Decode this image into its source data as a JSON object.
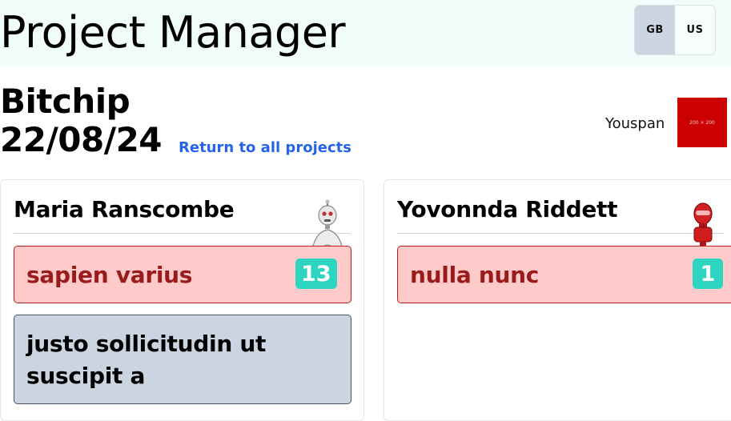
{
  "app": {
    "title": "Project Manager"
  },
  "locales": {
    "gb": "GB",
    "us": "US",
    "selected": "GB"
  },
  "project": {
    "name": "Bitchip",
    "date": "22/08/24",
    "return_link": "Return to all projects",
    "client": "Youspan",
    "client_logo_text": "200 × 200",
    "client_logo_color": "#cc0000"
  },
  "members": [
    {
      "name": "Maria Ranscombe",
      "avatar": "robot-avatar-white",
      "tasks": [
        {
          "title": "sapien varius",
          "count": "13",
          "status": "overdue"
        },
        {
          "title": "justo sollicitudin ut suscipit a",
          "status": "normal"
        }
      ]
    },
    {
      "name": "Yovonnda Riddett",
      "avatar": "robot-avatar-red",
      "tasks": [
        {
          "title": "nulla nunc",
          "count": "1",
          "status": "overdue"
        }
      ]
    }
  ],
  "colors": {
    "header_bg": "#f0fdfa",
    "overdue_bg": "#fecaca",
    "overdue_text": "#991b1b",
    "normal_bg": "#cbd5e1",
    "badge_bg": "#2dd4bf",
    "link": "#2563eb"
  }
}
